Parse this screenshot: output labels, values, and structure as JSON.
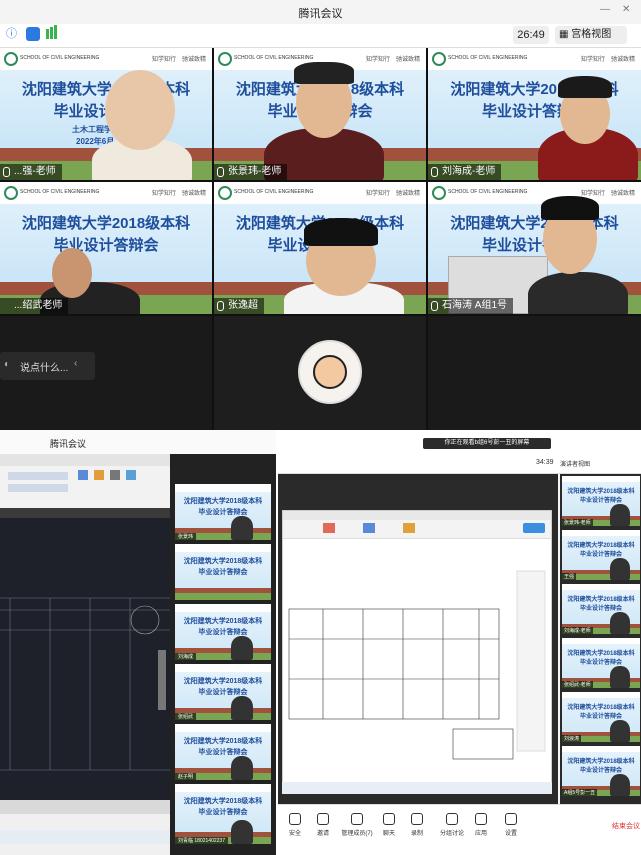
{
  "top": {
    "app_title": "腾讯会议",
    "timer": "26:49",
    "view_button": "宫格视图",
    "chat_placeholder": "说点什么...",
    "slide": {
      "title_line1": "沈阳建筑大学2018级本科",
      "title_line2": "毕业设计答辩会",
      "motto": "知学知行　驰诚致精",
      "school": "SCHOOL OF CIVIL ENGINEERING",
      "college": "土木工程学院",
      "date": "2022年6月"
    },
    "tiles": [
      {
        "name": "...强-老师"
      },
      {
        "name": "张景玮-老师"
      },
      {
        "name": "刘海成-老师"
      },
      {
        "name": "...绍武老师"
      },
      {
        "name": "张逸超"
      },
      {
        "name": "石海涛 A组1号"
      }
    ]
  },
  "bottom": {
    "left_title": "腾讯会议",
    "mini_slide_line1": "沈阳建筑大学2018级本科",
    "mini_slide_line2": "毕业设计答辩会",
    "mini_names": [
      "张景玮",
      "",
      "刘海成",
      "张绍武",
      "赵子明",
      "刘青临 18021402237"
    ],
    "right": {
      "banner": "你正在观看b组6号彭一丑的屏幕",
      "time": "34:39",
      "view": "演讲者视图",
      "mini_names": [
        "张景玮-老师",
        "王强",
        "刘海成-老师",
        "张绍武-老师",
        "刘浪涛",
        "A组5号彭一丑"
      ],
      "toolbar": [
        "安全",
        "邀请",
        "管理成员(7)",
        "聊天",
        "录制",
        "分组讨论",
        "应用",
        "设置"
      ],
      "end_button": "结束会议"
    }
  }
}
